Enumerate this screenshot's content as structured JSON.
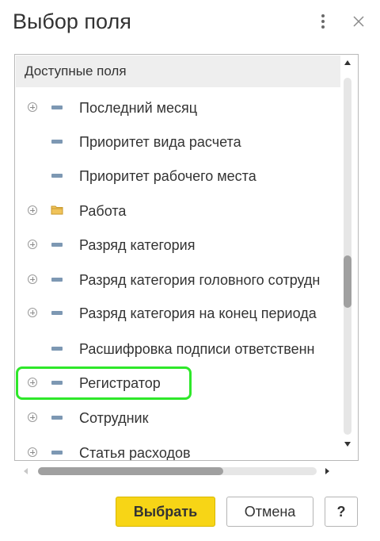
{
  "dialog": {
    "title": "Выбор поля"
  },
  "tree": {
    "header": "Доступные поля",
    "items": [
      {
        "label": "Последний месяц",
        "expandable": true,
        "icon": "field-icon"
      },
      {
        "label": "Приоритет вида расчета",
        "expandable": false,
        "icon": "field-icon"
      },
      {
        "label": "Приоритет рабочего места",
        "expandable": false,
        "icon": "field-icon"
      },
      {
        "label": "Работа",
        "expandable": true,
        "icon": "folder-icon"
      },
      {
        "label": "Разряд категория",
        "expandable": true,
        "icon": "field-icon"
      },
      {
        "label": "Разряд категория головного сотрудн",
        "expandable": true,
        "icon": "field-icon"
      },
      {
        "label": "Разряд категория на конец периода",
        "expandable": true,
        "icon": "field-icon"
      },
      {
        "label": "Расшифровка подписи ответственн",
        "expandable": false,
        "icon": "field-icon"
      },
      {
        "label": "Регистратор",
        "expandable": true,
        "icon": "field-icon",
        "highlighted": true
      },
      {
        "label": "Сотрудник",
        "expandable": true,
        "icon": "field-icon"
      },
      {
        "label": "Статья расходов",
        "expandable": true,
        "icon": "field-icon"
      }
    ]
  },
  "buttons": {
    "select": "Выбрать",
    "cancel": "Отмена",
    "help": "?"
  },
  "colors": {
    "primary_button": "#f7d516",
    "highlight": "#2ee82a",
    "field_icon": "#7d98b3",
    "folder_icon": "#f0c35a"
  }
}
